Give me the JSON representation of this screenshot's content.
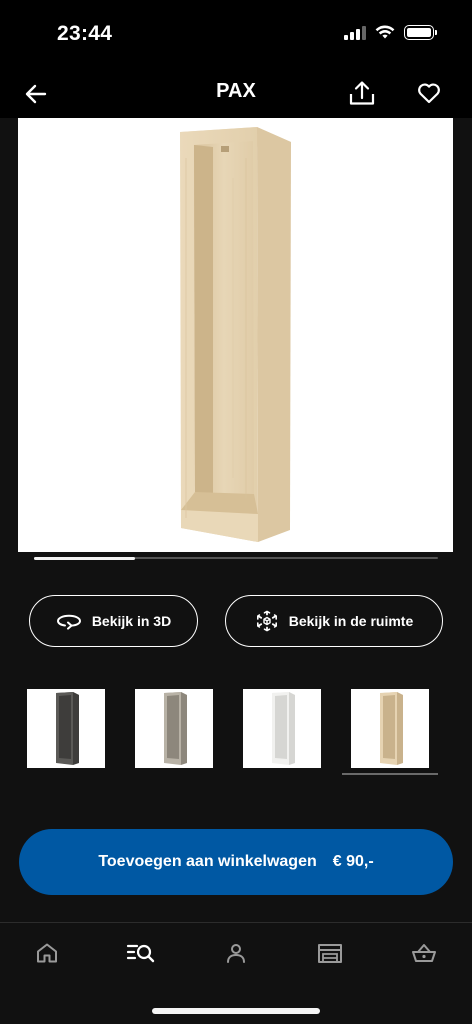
{
  "status_bar": {
    "time": "23:44"
  },
  "nav": {
    "title": "PAX"
  },
  "hero": {
    "carousel_progress": 0.25
  },
  "actions": {
    "view_3d_label": "Bekijk in 3D",
    "view_room_label": "Bekijk in de ruimte"
  },
  "variants": [
    {
      "color_name": "dark-grey",
      "body": "#5b5a57",
      "shade": "#3e3d3b"
    },
    {
      "color_name": "grey-beige",
      "body": "#b8b2a6",
      "shade": "#8d877c"
    },
    {
      "color_name": "white",
      "body": "#f1f1ef",
      "shade": "#d6d6d3"
    },
    {
      "color_name": "white-stained-oak",
      "body": "#e6d3b2",
      "shade": "#c9b28c",
      "selected": true
    }
  ],
  "cta": {
    "label": "Toevoegen aan winkelwagen",
    "price": "€ 90,-",
    "color": "#0058a3"
  },
  "tabbar": {
    "items": [
      {
        "icon": "home-icon"
      },
      {
        "icon": "search-icon",
        "active": true
      },
      {
        "icon": "profile-icon"
      },
      {
        "icon": "store-icon"
      },
      {
        "icon": "basket-icon"
      }
    ]
  }
}
